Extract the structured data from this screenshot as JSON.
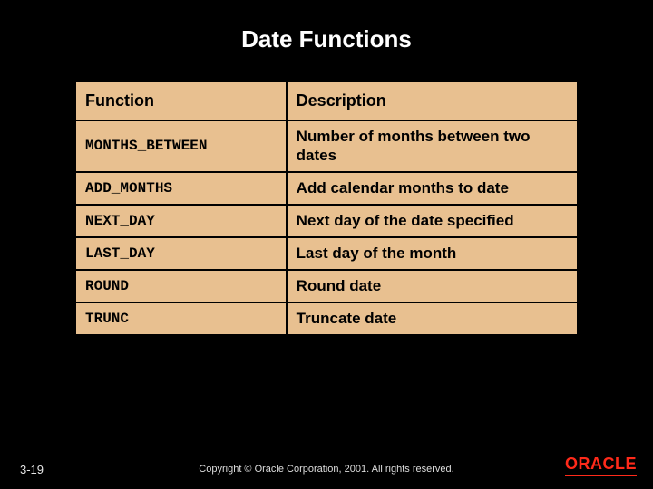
{
  "title": "Date Functions",
  "table": {
    "headers": {
      "col1": "Function",
      "col2": "Description"
    },
    "rows": [
      {
        "func": "MONTHS_BETWEEN",
        "desc": "Number of months between two dates"
      },
      {
        "func": "ADD_MONTHS",
        "desc": "Add calendar months to date"
      },
      {
        "func": "NEXT_DAY",
        "desc": "Next day of the date specified"
      },
      {
        "func": "LAST_DAY",
        "desc": "Last day of the month"
      },
      {
        "func": "ROUND",
        "desc": "Round date"
      },
      {
        "func": "TRUNC",
        "desc": "Truncate date"
      }
    ]
  },
  "footer": {
    "slide_number": "3-19",
    "copyright": "Copyright © Oracle Corporation, 2001. All rights reserved.",
    "logo_text": "ORACLE"
  }
}
